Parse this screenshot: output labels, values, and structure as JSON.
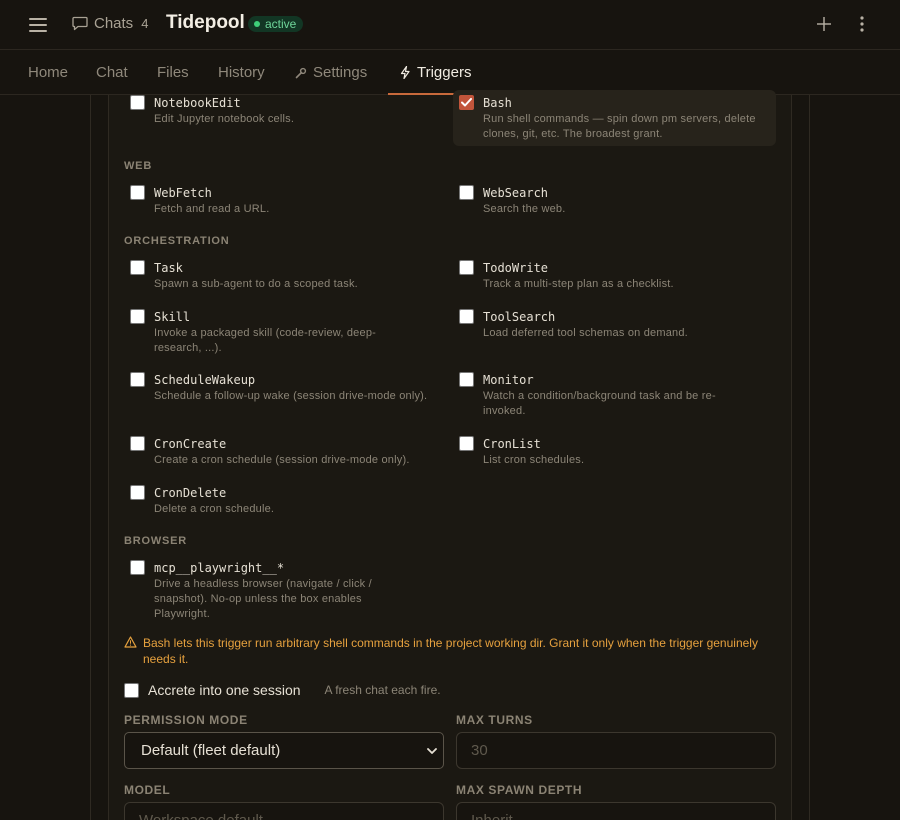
{
  "header": {
    "chats_label": "Chats",
    "chats_count": "4",
    "title": "Tidepool",
    "status": "active"
  },
  "tabs": [
    {
      "label": "Home"
    },
    {
      "label": "Chat"
    },
    {
      "label": "Files"
    },
    {
      "label": "History"
    },
    {
      "label": "Settings"
    },
    {
      "label": "Triggers"
    }
  ],
  "sections": {
    "web": "WEB",
    "orchestration": "ORCHESTRATION",
    "browser": "BROWSER"
  },
  "tools": {
    "notebookedit": {
      "name": "NotebookEdit",
      "desc": "Edit Jupyter notebook cells.",
      "checked": false
    },
    "bash": {
      "name": "Bash",
      "desc": "Run shell commands — spin down pm servers, delete clones, git, etc. The broadest grant.",
      "checked": true
    },
    "webfetch": {
      "name": "WebFetch",
      "desc": "Fetch and read a URL.",
      "checked": false
    },
    "websearch": {
      "name": "WebSearch",
      "desc": "Search the web.",
      "checked": false
    },
    "task": {
      "name": "Task",
      "desc": "Spawn a sub-agent to do a scoped task.",
      "checked": false
    },
    "todowrite": {
      "name": "TodoWrite",
      "desc": "Track a multi-step plan as a checklist.",
      "checked": false
    },
    "skill": {
      "name": "Skill",
      "desc": "Invoke a packaged skill (code-review, deep-research, ...).",
      "checked": false
    },
    "toolsearch": {
      "name": "ToolSearch",
      "desc": "Load deferred tool schemas on demand.",
      "checked": false
    },
    "schedulewakeup": {
      "name": "ScheduleWakeup",
      "desc": "Schedule a follow-up wake (session drive-mode only).",
      "checked": false
    },
    "monitor": {
      "name": "Monitor",
      "desc": "Watch a condition/background task and be re-invoked.",
      "checked": false
    },
    "croncreate": {
      "name": "CronCreate",
      "desc": "Create a cron schedule (session drive-mode only).",
      "checked": false
    },
    "cronlist": {
      "name": "CronList",
      "desc": "List cron schedules.",
      "checked": false
    },
    "crondelete": {
      "name": "CronDelete",
      "desc": "Delete a cron schedule.",
      "checked": false
    },
    "playwright": {
      "name": "mcp__playwright__*",
      "desc": "Drive a headless browser (navigate / click / snapshot). No-op unless the box enables Playwright.",
      "checked": false
    }
  },
  "warning": "Bash lets this trigger run arbitrary shell commands in the project working dir. Grant it only when the trigger genuinely needs it.",
  "accrete": {
    "label": "Accrete into one session",
    "hint": "A fresh chat each fire.",
    "checked": false
  },
  "form": {
    "permission_mode_label": "PERMISSION MODE",
    "permission_mode_value": "Default (fleet default)",
    "max_turns_label": "MAX TURNS",
    "max_turns_placeholder": "30",
    "model_label": "MODEL",
    "model_placeholder": "Workspace default",
    "max_spawn_depth_label": "MAX SPAWN DEPTH",
    "max_spawn_depth_placeholder": "Inherit"
  },
  "colors": {
    "accent": "#c8693b",
    "status_green": "#3ecf79",
    "warning": "#e6a13e",
    "background": "#17140f"
  },
  "icons": {
    "menu": "menu-icon",
    "chats": "chat-bubble-icon",
    "settings": "wrench-icon",
    "triggers": "bolt-icon",
    "add": "plus-icon",
    "more": "kebab-icon",
    "warning": "warning-triangle-icon"
  }
}
